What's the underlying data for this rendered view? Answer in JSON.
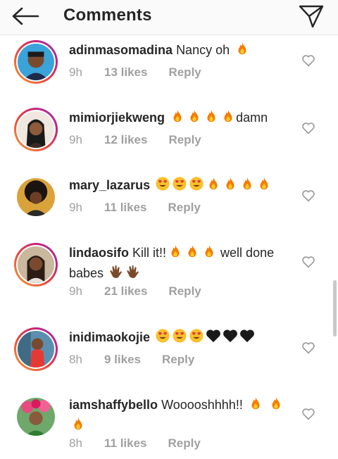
{
  "header": {
    "title": "Comments",
    "back_icon": "arrow-left-icon",
    "share_icon": "paper-plane-icon"
  },
  "comments": [
    {
      "username": "adinmasomadina",
      "text": "Nancy oh",
      "emoji": [
        "fire"
      ],
      "time": "9h",
      "likes": "13 likes",
      "reply": "Reply",
      "ring": true
    },
    {
      "username": "mimiorjiekweng",
      "text": "",
      "emoji": [
        "fire",
        "fire",
        "fire",
        "fire"
      ],
      "text_after": "damn",
      "time": "9h",
      "likes": "12 likes",
      "reply": "Reply",
      "ring": true
    },
    {
      "username": "mary_lazarus",
      "text": "",
      "emoji": [
        "heart-eyes",
        "heart-eyes",
        "heart-eyes",
        "fire",
        "fire",
        "fire",
        "fire"
      ],
      "time": "9h",
      "likes": "11 likes",
      "reply": "Reply",
      "ring": false
    },
    {
      "username": "lindaosifo",
      "text": "Kill it!!",
      "emoji": [
        "fire",
        "fire",
        "fire"
      ],
      "text_after": "well done babes",
      "emoji_after": [
        "clap",
        "clap"
      ],
      "time": "9h",
      "likes": "21 likes",
      "reply": "Reply",
      "ring": true
    },
    {
      "username": "inidimaokojie",
      "text": "",
      "emoji": [
        "heart-eyes",
        "heart-eyes",
        "heart-eyes",
        "black-heart",
        "black-heart",
        "black-heart"
      ],
      "time": "8h",
      "likes": "9 likes",
      "reply": "Reply",
      "ring": true
    },
    {
      "username": "iamshaffybello",
      "text": "Wooooshhhh!!",
      "emoji": [
        "fire",
        "fire",
        "fire"
      ],
      "time": "8h",
      "likes": "11 likes",
      "reply": "Reply",
      "ring": false
    }
  ],
  "colors": {
    "text": "#262626",
    "meta": "#a0a0a0",
    "fire": "#f57c00",
    "heart_eyes_face": "#fbc02d",
    "ring_gradient": [
      "#f9a13b",
      "#e8403e",
      "#c5237d",
      "#8a3ab9"
    ]
  }
}
